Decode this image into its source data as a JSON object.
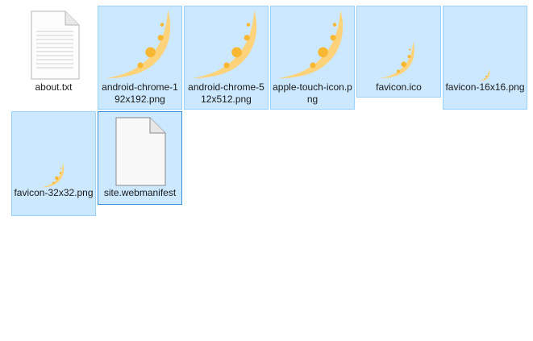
{
  "files": [
    {
      "name": "about.txt",
      "icon": "text-file-icon",
      "selected": false
    },
    {
      "name": "android-chrome-192x192.png",
      "icon": "crescent-moon-thumbnail",
      "selected": true
    },
    {
      "name": "android-chrome-512x512.png",
      "icon": "crescent-moon-thumbnail",
      "selected": true
    },
    {
      "name": "apple-touch-icon.png",
      "icon": "crescent-moon-thumbnail",
      "selected": true
    },
    {
      "name": "favicon.ico",
      "icon": "crescent-moon-thumbnail",
      "selected": true
    },
    {
      "name": "favicon-16x16.png",
      "icon": "crescent-moon-thumbnail",
      "selected": true
    },
    {
      "name": "favicon-32x32.png",
      "icon": "crescent-moon-thumbnail",
      "selected": true
    },
    {
      "name": "site.webmanifest",
      "icon": "blank-file-icon",
      "selected": true
    }
  ],
  "colors": {
    "selection_fill": "#cce8ff",
    "selection_border": "#99d1ff",
    "focus_border": "#3a8fd8",
    "moon": "#fcd27a",
    "moon_spot": "#f7b731"
  }
}
